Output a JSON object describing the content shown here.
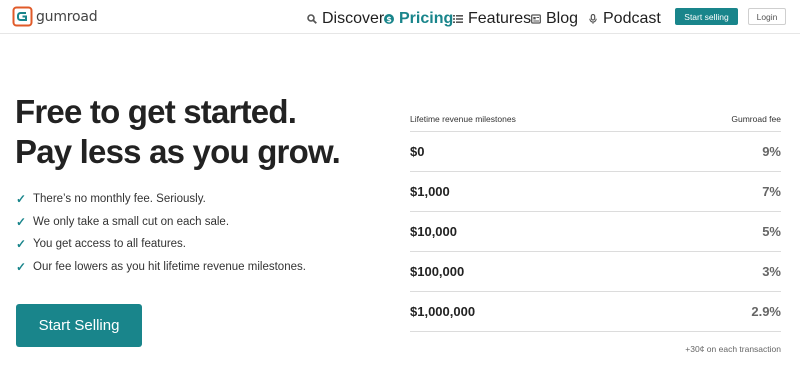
{
  "brand": {
    "name": "gumroad"
  },
  "nav": {
    "items": [
      {
        "label": "Discover",
        "icon": "search-icon"
      },
      {
        "label": "Pricing",
        "icon": "dollar-icon",
        "active": true
      },
      {
        "label": "Features",
        "icon": "list-icon"
      },
      {
        "label": "Blog",
        "icon": "newspaper-icon"
      },
      {
        "label": "Podcast",
        "icon": "microphone-icon"
      }
    ],
    "start_selling": "Start selling",
    "login": "Login"
  },
  "hero": {
    "headline_line1": "Free to get started.",
    "headline_line2": "Pay less as you grow.",
    "features": [
      "There’s no monthly fee. Seriously.",
      "We only take a small cut on each sale.",
      "You get access to all features.",
      "Our fee lowers as you hit lifetime revenue milestones."
    ],
    "cta": "Start Selling"
  },
  "pricing_table": {
    "header_left": "Lifetime revenue milestones",
    "header_right": "Gumroad fee",
    "rows": [
      {
        "milestone": "$0",
        "fee": "9%"
      },
      {
        "milestone": "$1,000",
        "fee": "7%"
      },
      {
        "milestone": "$10,000",
        "fee": "5%"
      },
      {
        "milestone": "$100,000",
        "fee": "3%"
      },
      {
        "milestone": "$1,000,000",
        "fee": "2.9%"
      }
    ],
    "note": "+30¢ on each transaction"
  },
  "colors": {
    "accent": "#19858b",
    "logo_orange": "#e05a28"
  }
}
